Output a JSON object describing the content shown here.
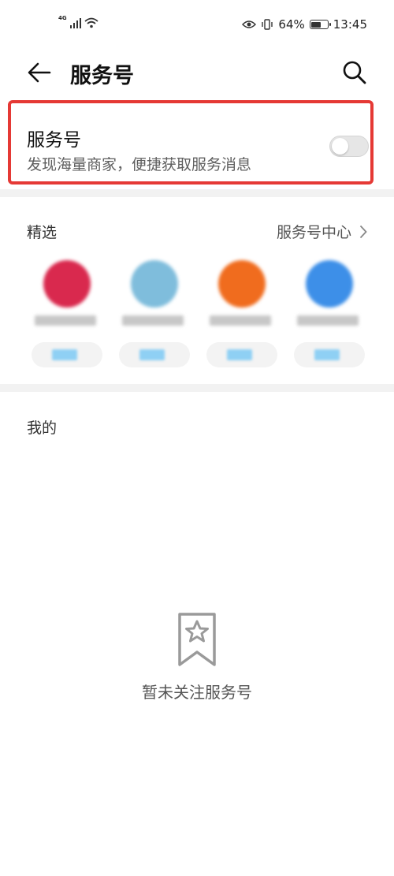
{
  "status_bar": {
    "network": "4G",
    "battery": "64%",
    "battery_level": 0.64,
    "time": "13:45"
  },
  "header": {
    "title": "服务号"
  },
  "promo": {
    "title": "服务号",
    "subtitle": "发现海量商家，便捷获取服务消息",
    "toggle_on": false
  },
  "featured": {
    "title": "精选",
    "center_link": "服务号中心",
    "items": [
      {
        "avatar_color": "#d9294e"
      },
      {
        "avatar_color": "#7fbddc"
      },
      {
        "avatar_color": "#f06c1e"
      },
      {
        "avatar_color": "#3d8fe8"
      }
    ]
  },
  "mine": {
    "title": "我的",
    "empty_text": "暂未关注服务号"
  },
  "colors": {
    "highlight_border": "#e53935",
    "divider": "#f2f2f2",
    "follow_accent": "#8fd0f4"
  }
}
